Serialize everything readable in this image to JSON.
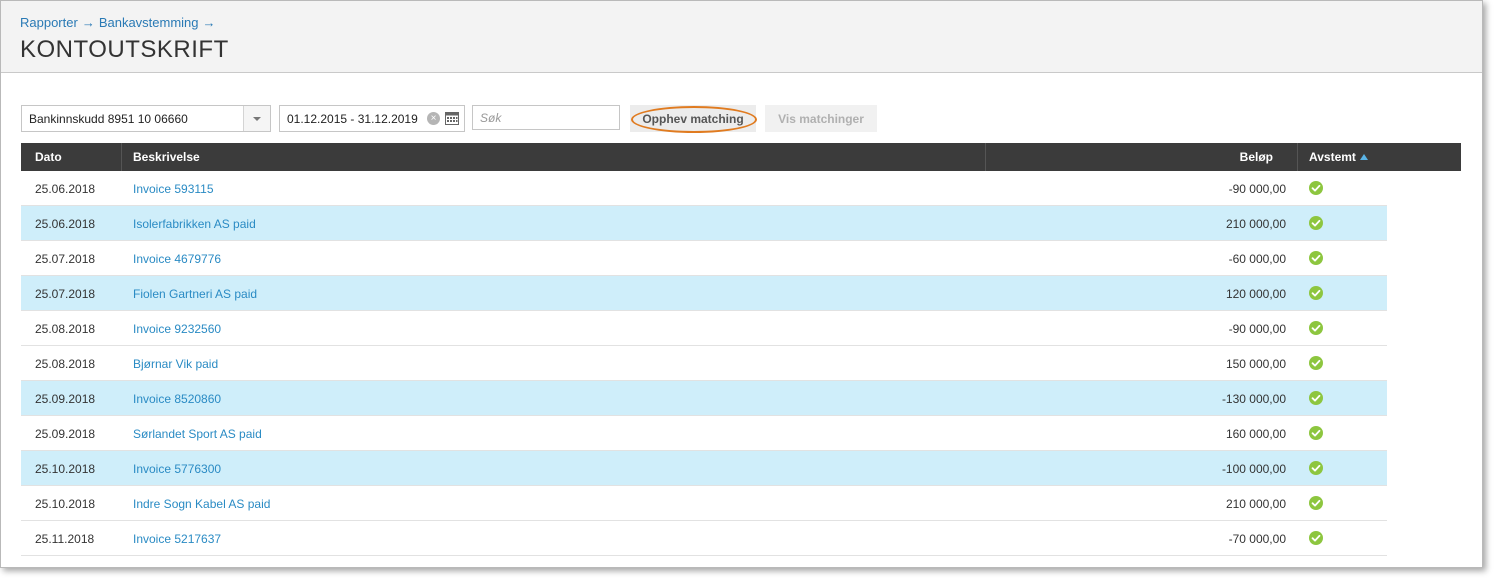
{
  "breadcrumb": {
    "items": [
      "Rapporter",
      "Bankavstemming"
    ],
    "separator": "→"
  },
  "page": {
    "title": "KONTOUTSKRIFT"
  },
  "filters": {
    "account": "Bankinnskudd 8951 10 06660",
    "date_range": "01.12.2015 - 31.12.2019",
    "search_placeholder": "Søk",
    "unmatch_button": "Opphev matching",
    "show_matches_button": "Vis matchinger"
  },
  "table": {
    "headers": {
      "date": "Dato",
      "description": "Beskrivelse",
      "amount": "Beløp",
      "reconciled": "Avstemt"
    },
    "rows": [
      {
        "date": "25.06.2018",
        "description": "Invoice 593115",
        "amount": "-90 000,00",
        "highlighted": false
      },
      {
        "date": "25.06.2018",
        "description": "Isolerfabrikken AS paid",
        "amount": "210 000,00",
        "highlighted": true
      },
      {
        "date": "25.07.2018",
        "description": "Invoice 4679776",
        "amount": "-60 000,00",
        "highlighted": false
      },
      {
        "date": "25.07.2018",
        "description": "Fiolen Gartneri AS paid",
        "amount": "120 000,00",
        "highlighted": true
      },
      {
        "date": "25.08.2018",
        "description": "Invoice 9232560",
        "amount": "-90 000,00",
        "highlighted": false
      },
      {
        "date": "25.08.2018",
        "description": "Bjørnar Vik paid",
        "amount": "150 000,00",
        "highlighted": false
      },
      {
        "date": "25.09.2018",
        "description": "Invoice 8520860",
        "amount": "-130 000,00",
        "highlighted": true
      },
      {
        "date": "25.09.2018",
        "description": "Sørlandet Sport AS paid",
        "amount": "160 000,00",
        "highlighted": false
      },
      {
        "date": "25.10.2018",
        "description": "Invoice 5776300",
        "amount": "-100 000,00",
        "highlighted": true
      },
      {
        "date": "25.10.2018",
        "description": "Indre Sogn Kabel AS paid",
        "amount": "210 000,00",
        "highlighted": false
      },
      {
        "date": "25.11.2018",
        "description": "Invoice 5217637",
        "amount": "-70 000,00",
        "highlighted": false
      }
    ]
  },
  "colors": {
    "link": "#2a8bc4",
    "header_bg": "#3b3b3b",
    "highlight_row": "#cfeefa",
    "check": "#8dc63f",
    "annotation_ring": "#e07b20"
  }
}
